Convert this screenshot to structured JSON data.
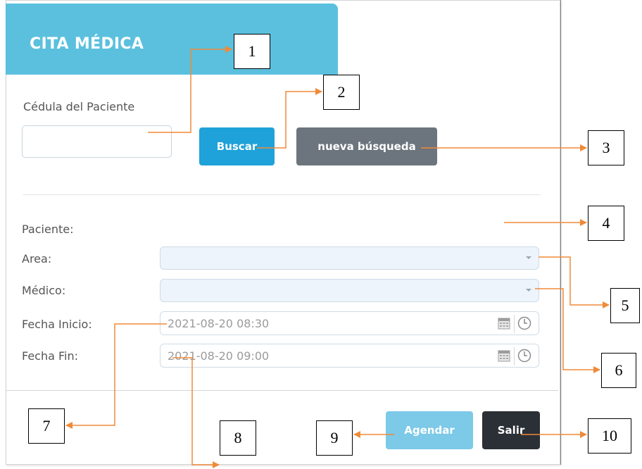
{
  "header": {
    "title": "CITA MÉDICA"
  },
  "search": {
    "label": "Cédula del Paciente",
    "input_value": "",
    "buscar_label": "Buscar",
    "nueva_label": "nueva búsqueda"
  },
  "form": {
    "paciente_label": "Paciente:",
    "area_label": "Area:",
    "medico_label": "Médico:",
    "fecha_inicio_label": "Fecha Inicio:",
    "fecha_inicio_value": "2021-08-20 08:30",
    "fecha_fin_label": "Fecha Fin:",
    "fecha_fin_value": "2021-08-20 09:00"
  },
  "footer": {
    "agendar_label": "Agendar",
    "salir_label": "Salir"
  },
  "callouts": [
    "1",
    "2",
    "3",
    "4",
    "5",
    "6",
    "7",
    "8",
    "9",
    "10"
  ],
  "colors": {
    "header": "#5bc0de",
    "buscar": "#1fa2d9",
    "nueva": "#6c757d",
    "agendar": "#7cc9e8",
    "salir": "#2b2f36",
    "arrow": "#f08a38"
  }
}
